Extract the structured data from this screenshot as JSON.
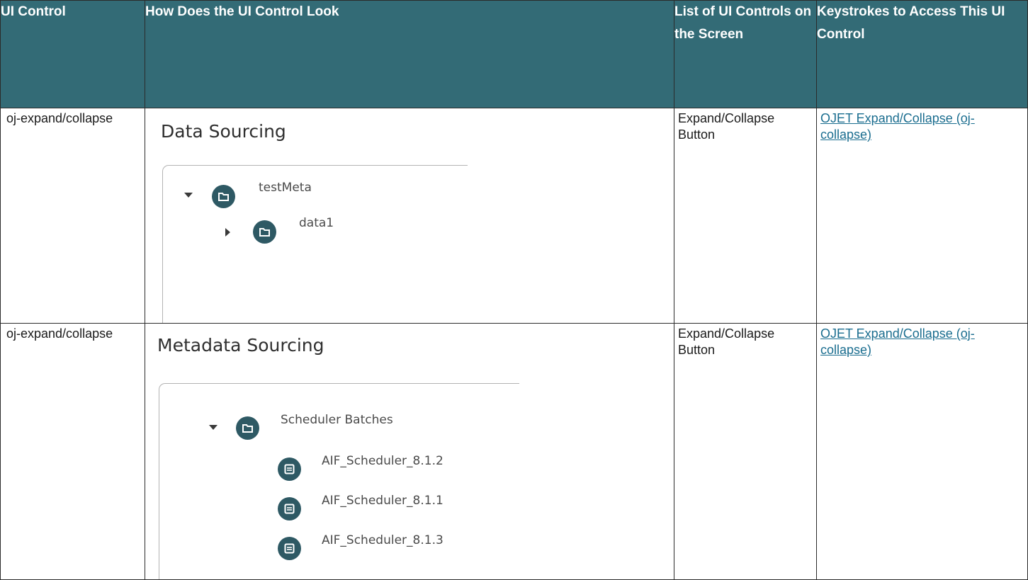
{
  "headers": [
    "UI Control",
    "How Does the UI Control Look",
    "List of UI Controls on the Screen",
    "Keystrokes to Access This UI Control"
  ],
  "rows": [
    {
      "control": "oj-expand/collapse",
      "illustration": {
        "heading": "Data Sourcing",
        "nodes": [
          {
            "label": "testMeta",
            "state": "expanded",
            "icon": "folder-icon"
          },
          {
            "label": "data1",
            "state": "collapsed",
            "icon": "folder-icon"
          }
        ]
      },
      "controls_list": "Expand/Collapse Button",
      "keystrokes_link": "OJET Expand/Collapse (oj-collapse)"
    },
    {
      "control": "oj-expand/collapse",
      "illustration": {
        "heading": "Metadata Sourcing",
        "nodes": [
          {
            "label": "Scheduler Batches",
            "state": "expanded",
            "icon": "folder-icon"
          },
          {
            "label": "AIF_Scheduler_8.1.2",
            "state": "leaf",
            "icon": "document-icon"
          },
          {
            "label": "AIF_Scheduler_8.1.1",
            "state": "leaf",
            "icon": "document-icon"
          },
          {
            "label": "AIF_Scheduler_8.1.3",
            "state": "leaf",
            "icon": "document-icon"
          }
        ]
      },
      "controls_list": "Expand/Collapse Button",
      "keystrokes_link": "OJET Expand/Collapse (oj-collapse)"
    }
  ],
  "colors": {
    "header_bg": "#336b76",
    "node_icon_bg": "#2e5964",
    "link": "#1a6d8f"
  }
}
